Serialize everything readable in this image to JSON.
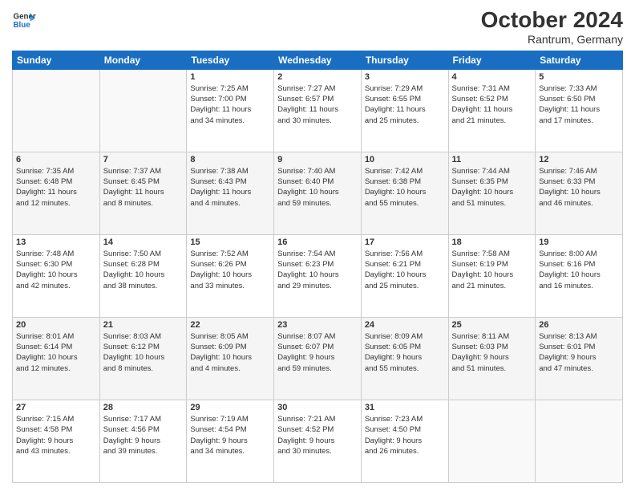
{
  "header": {
    "logo_general": "General",
    "logo_blue": "Blue",
    "title": "October 2024",
    "subtitle": "Rantrum, Germany"
  },
  "days_of_week": [
    "Sunday",
    "Monday",
    "Tuesday",
    "Wednesday",
    "Thursday",
    "Friday",
    "Saturday"
  ],
  "weeks": [
    {
      "shade": "white",
      "days": [
        {
          "num": "",
          "info": ""
        },
        {
          "num": "",
          "info": ""
        },
        {
          "num": "1",
          "info": "Sunrise: 7:25 AM\nSunset: 7:00 PM\nDaylight: 11 hours\nand 34 minutes."
        },
        {
          "num": "2",
          "info": "Sunrise: 7:27 AM\nSunset: 6:57 PM\nDaylight: 11 hours\nand 30 minutes."
        },
        {
          "num": "3",
          "info": "Sunrise: 7:29 AM\nSunset: 6:55 PM\nDaylight: 11 hours\nand 25 minutes."
        },
        {
          "num": "4",
          "info": "Sunrise: 7:31 AM\nSunset: 6:52 PM\nDaylight: 11 hours\nand 21 minutes."
        },
        {
          "num": "5",
          "info": "Sunrise: 7:33 AM\nSunset: 6:50 PM\nDaylight: 11 hours\nand 17 minutes."
        }
      ]
    },
    {
      "shade": "shade",
      "days": [
        {
          "num": "6",
          "info": "Sunrise: 7:35 AM\nSunset: 6:48 PM\nDaylight: 11 hours\nand 12 minutes."
        },
        {
          "num": "7",
          "info": "Sunrise: 7:37 AM\nSunset: 6:45 PM\nDaylight: 11 hours\nand 8 minutes."
        },
        {
          "num": "8",
          "info": "Sunrise: 7:38 AM\nSunset: 6:43 PM\nDaylight: 11 hours\nand 4 minutes."
        },
        {
          "num": "9",
          "info": "Sunrise: 7:40 AM\nSunset: 6:40 PM\nDaylight: 10 hours\nand 59 minutes."
        },
        {
          "num": "10",
          "info": "Sunrise: 7:42 AM\nSunset: 6:38 PM\nDaylight: 10 hours\nand 55 minutes."
        },
        {
          "num": "11",
          "info": "Sunrise: 7:44 AM\nSunset: 6:35 PM\nDaylight: 10 hours\nand 51 minutes."
        },
        {
          "num": "12",
          "info": "Sunrise: 7:46 AM\nSunset: 6:33 PM\nDaylight: 10 hours\nand 46 minutes."
        }
      ]
    },
    {
      "shade": "white",
      "days": [
        {
          "num": "13",
          "info": "Sunrise: 7:48 AM\nSunset: 6:30 PM\nDaylight: 10 hours\nand 42 minutes."
        },
        {
          "num": "14",
          "info": "Sunrise: 7:50 AM\nSunset: 6:28 PM\nDaylight: 10 hours\nand 38 minutes."
        },
        {
          "num": "15",
          "info": "Sunrise: 7:52 AM\nSunset: 6:26 PM\nDaylight: 10 hours\nand 33 minutes."
        },
        {
          "num": "16",
          "info": "Sunrise: 7:54 AM\nSunset: 6:23 PM\nDaylight: 10 hours\nand 29 minutes."
        },
        {
          "num": "17",
          "info": "Sunrise: 7:56 AM\nSunset: 6:21 PM\nDaylight: 10 hours\nand 25 minutes."
        },
        {
          "num": "18",
          "info": "Sunrise: 7:58 AM\nSunset: 6:19 PM\nDaylight: 10 hours\nand 21 minutes."
        },
        {
          "num": "19",
          "info": "Sunrise: 8:00 AM\nSunset: 6:16 PM\nDaylight: 10 hours\nand 16 minutes."
        }
      ]
    },
    {
      "shade": "shade",
      "days": [
        {
          "num": "20",
          "info": "Sunrise: 8:01 AM\nSunset: 6:14 PM\nDaylight: 10 hours\nand 12 minutes."
        },
        {
          "num": "21",
          "info": "Sunrise: 8:03 AM\nSunset: 6:12 PM\nDaylight: 10 hours\nand 8 minutes."
        },
        {
          "num": "22",
          "info": "Sunrise: 8:05 AM\nSunset: 6:09 PM\nDaylight: 10 hours\nand 4 minutes."
        },
        {
          "num": "23",
          "info": "Sunrise: 8:07 AM\nSunset: 6:07 PM\nDaylight: 9 hours\nand 59 minutes."
        },
        {
          "num": "24",
          "info": "Sunrise: 8:09 AM\nSunset: 6:05 PM\nDaylight: 9 hours\nand 55 minutes."
        },
        {
          "num": "25",
          "info": "Sunrise: 8:11 AM\nSunset: 6:03 PM\nDaylight: 9 hours\nand 51 minutes."
        },
        {
          "num": "26",
          "info": "Sunrise: 8:13 AM\nSunset: 6:01 PM\nDaylight: 9 hours\nand 47 minutes."
        }
      ]
    },
    {
      "shade": "white",
      "days": [
        {
          "num": "27",
          "info": "Sunrise: 7:15 AM\nSunset: 4:58 PM\nDaylight: 9 hours\nand 43 minutes."
        },
        {
          "num": "28",
          "info": "Sunrise: 7:17 AM\nSunset: 4:56 PM\nDaylight: 9 hours\nand 39 minutes."
        },
        {
          "num": "29",
          "info": "Sunrise: 7:19 AM\nSunset: 4:54 PM\nDaylight: 9 hours\nand 34 minutes."
        },
        {
          "num": "30",
          "info": "Sunrise: 7:21 AM\nSunset: 4:52 PM\nDaylight: 9 hours\nand 30 minutes."
        },
        {
          "num": "31",
          "info": "Sunrise: 7:23 AM\nSunset: 4:50 PM\nDaylight: 9 hours\nand 26 minutes."
        },
        {
          "num": "",
          "info": ""
        },
        {
          "num": "",
          "info": ""
        }
      ]
    }
  ]
}
